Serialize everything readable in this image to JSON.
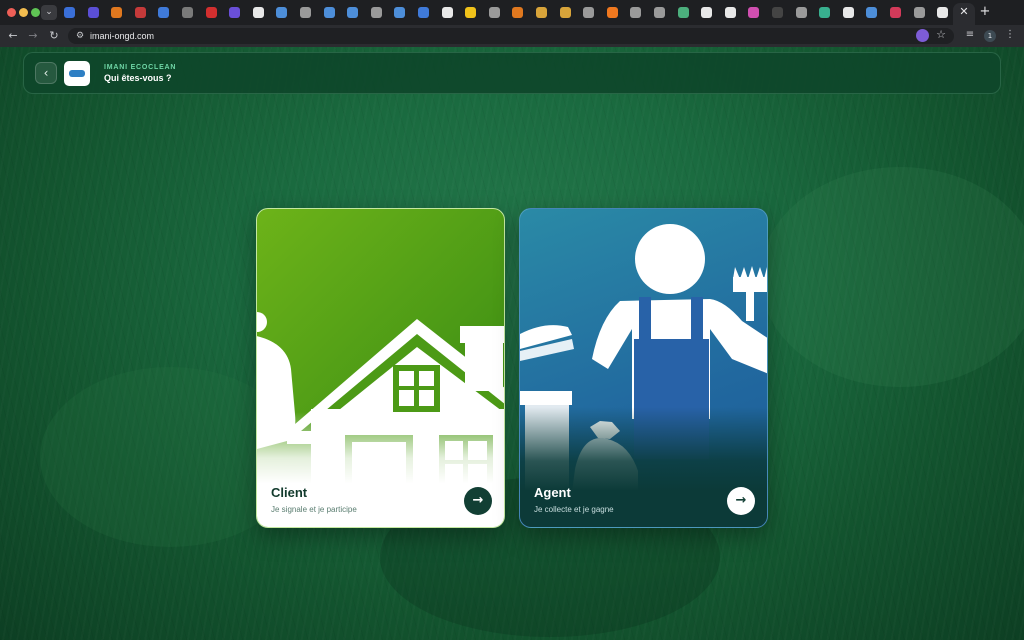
{
  "browser": {
    "url": "imani-ongd.com",
    "profile_initial": "1",
    "tab_colors": [
      "#3a6fd8",
      "#5b4fd6",
      "#e0781f",
      "#c53a3a",
      "#3f7ad9",
      "#7a7a7a",
      "#d22f2f",
      "#6a4fd9",
      "#e8e8e8",
      "#4d8ed9",
      "#9a9a9a",
      "#4d8ed9",
      "#4d8ed9",
      "#9a9a9a",
      "#4d8ed9",
      "#3f7ad9",
      "#e8e8e8",
      "#f0c21a",
      "#9a9a9a",
      "#e0781f",
      "#d8a43a",
      "#d8a43a",
      "#9a9a9a",
      "#f0781f",
      "#9a9a9a",
      "#9a9a9a",
      "#4caf7d",
      "#e8e8e8",
      "#e8e8e8",
      "#d04fb0",
      "#444444",
      "#9a9a9a",
      "#38b08f",
      "#e8e8e8",
      "#4d8ed9",
      "#d33a5a",
      "#9a9a9a",
      "#e8e8e8"
    ],
    "icons": {
      "chevron": "chevron-down-icon",
      "close": "close-icon",
      "new_tab": "plus-icon",
      "back": "arrow-left-icon",
      "forward": "arrow-right-icon",
      "reload": "reload-icon",
      "site_info": "site-info-icon",
      "bookmark": "star-icon",
      "extension": "extension-icon",
      "tab_search": "tab-search-icon",
      "menu": "more-vertical-icon"
    },
    "glyphs": {
      "chevron": "⌄",
      "close": "✕",
      "new_tab": "+",
      "back": "←",
      "forward": "→",
      "reload": "↻",
      "site_info": "⚙",
      "bookmark": "☆",
      "tab_search": "≡",
      "menu": "⋮"
    }
  },
  "header": {
    "back_glyph": "‹",
    "logo_icon": "imani-logo-icon",
    "brand": "IMANI ECOCLEAN",
    "title": "Qui êtes-vous ?"
  },
  "cards": [
    {
      "title": "Client",
      "subtitle": "Je signale et je participe",
      "illustration": "house-person-illustration",
      "arrow_glyph": "→",
      "accent": "#4c9a16"
    },
    {
      "title": "Agent",
      "subtitle": "Je collecte et je gagne",
      "illustration": "cleaner-worker-illustration",
      "arrow_glyph": "→",
      "accent": "#21689f"
    }
  ],
  "colors": {
    "page_bg": "#13552f",
    "brand_text": "#6fd6a6",
    "button_dark": "#123f34"
  }
}
